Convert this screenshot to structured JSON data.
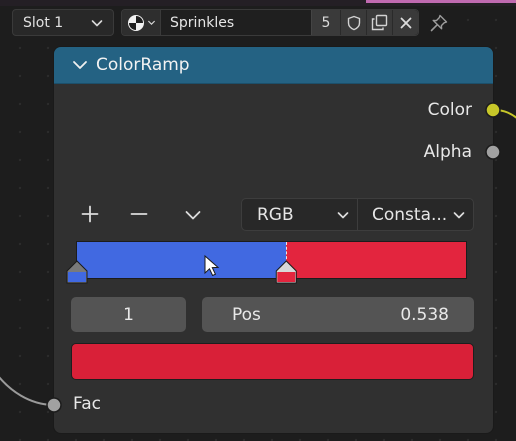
{
  "header": {
    "slot_select": {
      "label": "Slot 1"
    },
    "material": {
      "name": "Sprinkles",
      "user_count": "5",
      "browse_icon": "material-sphere-icon",
      "fake_user_icon": "shield-icon",
      "duplicate_icon": "duplicate-icon",
      "unlink_icon": "close-icon"
    },
    "pin_icon": "pin-icon"
  },
  "node": {
    "title": "ColorRamp",
    "header_color": "#246283",
    "outputs": [
      {
        "label": "Color",
        "socket_color": "#c7c729"
      },
      {
        "label": "Alpha",
        "socket_color": "#a1a1a1"
      }
    ],
    "toolbar": {
      "add_icon": "plus-icon",
      "remove_icon": "minus-icon",
      "menu_icon": "chevron-down-icon"
    },
    "color_mode": "RGB",
    "interpolation": "Consta...",
    "ramp": {
      "stops": [
        {
          "position": 0.0,
          "color": "#4169e1"
        },
        {
          "position": 0.538,
          "color": "#e3253e"
        }
      ],
      "active_stop_index": "1"
    },
    "active_stop": {
      "index": "1",
      "pos_label": "Pos",
      "pos_value": "0.538",
      "color": "#d92038"
    },
    "inputs": [
      {
        "label": "Fac",
        "socket_color": "#a1a1a1"
      }
    ]
  }
}
